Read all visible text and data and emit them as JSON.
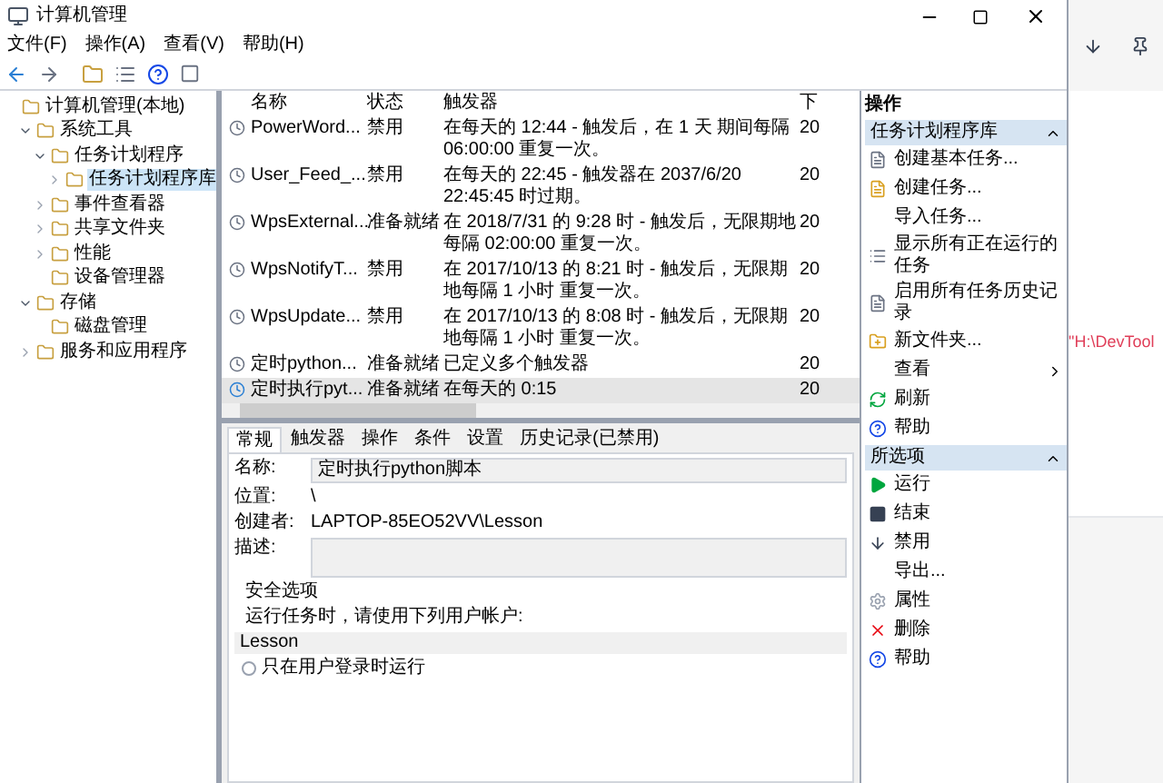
{
  "window": {
    "title": "计算机管理"
  },
  "menu": [
    "文件(F)",
    "操作(A)",
    "查看(V)",
    "帮助(H)"
  ],
  "tree": {
    "label": "计算机管理(本地)",
    "selected": false,
    "children": [
      {
        "label": "系统工具",
        "expanded": true,
        "selected": false,
        "children": [
          {
            "label": "任务计划程序",
            "expanded": true,
            "selected": false,
            "children": [
              {
                "label": "任务计划程序库",
                "expanded": false,
                "selected": true
              }
            ]
          },
          {
            "label": "事件查看器",
            "expanded": false,
            "selected": false
          },
          {
            "label": "共享文件夹",
            "expanded": false,
            "selected": false
          },
          {
            "label": "性能",
            "expanded": false,
            "selected": false
          },
          {
            "label": "设备管理器",
            "selected": false
          }
        ]
      },
      {
        "label": "存储",
        "expanded": true,
        "selected": false,
        "children": [
          {
            "label": "磁盘管理",
            "selected": false
          }
        ]
      },
      {
        "label": "服务和应用程序",
        "expanded": false,
        "selected": false
      }
    ]
  },
  "table": {
    "columns": [
      "名称",
      "状态",
      "触发器",
      "下"
    ],
    "rows": [
      {
        "cells": [
          "PowerWord...",
          "禁用",
          "在每天的 12:44 - 触发后，在 1 天 期间每隔 06:00:00 重复一次。",
          "20"
        ],
        "selected": false
      },
      {
        "cells": [
          "User_Feed_...",
          "禁用",
          "在每天的 22:45 - 触发器在 2037/6/20 22:45:45 时过期。",
          "20"
        ],
        "selected": false
      },
      {
        "cells": [
          "WpsExternal...",
          "准备就绪",
          "在 2018/7/31 的 9:28 时 - 触发后，无限期地每隔 02:00:00 重复一次。",
          "20"
        ],
        "selected": false
      },
      {
        "cells": [
          "WpsNotifyT...",
          "禁用",
          "在 2017/10/13 的 8:21 时 - 触发后，无限期地每隔 1 小时 重复一次。",
          "20"
        ],
        "selected": false
      },
      {
        "cells": [
          "WpsUpdate...",
          "禁用",
          "在 2017/10/13 的 8:08 时 - 触发后，无限期地每隔 1 小时 重复一次。",
          "20"
        ],
        "selected": false
      },
      {
        "cells": [
          "定时python...",
          "准备就绪",
          "已定义多个触发器",
          "20"
        ],
        "selected": false
      },
      {
        "cells": [
          "定时执行pyt...",
          "准备就绪",
          "在每天的 0:15",
          "20"
        ],
        "selected": true
      }
    ]
  },
  "detail": {
    "tabs": [
      {
        "label": "常规",
        "selected": true
      },
      {
        "label": "触发器",
        "selected": false
      },
      {
        "label": "操作",
        "selected": false
      },
      {
        "label": "条件",
        "selected": false
      },
      {
        "label": "设置",
        "selected": false
      },
      {
        "label": "历史记录(已禁用)",
        "selected": false
      }
    ],
    "fields": [
      {
        "label": "名称:",
        "value": "定时执行python脚本",
        "kind": "input"
      },
      {
        "label": "位置:",
        "value": "\\",
        "kind": "text"
      },
      {
        "label": "创建者:",
        "value": "LAPTOP-85EO52VV\\Lesson",
        "kind": "text"
      },
      {
        "label": "描述:",
        "kind": "area"
      }
    ],
    "security_title": "安全选项",
    "security_prompt": "运行任务时，请使用下列用户帐户:",
    "account": "Lesson",
    "option": {
      "label": "只在用户登录时运行",
      "checked": false
    }
  },
  "actions": {
    "title": "操作",
    "sections": [
      {
        "title": "任务计划程序库",
        "items": [
          {
            "label": "创建基本任务...",
            "kind": "basic"
          },
          {
            "label": "创建任务...",
            "kind": "task"
          },
          {
            "label": "导入任务...",
            "kind": "none"
          },
          {
            "label": "显示所有正在运行的任务",
            "kind": "running"
          },
          {
            "label": "启用所有任务历史记录",
            "kind": "history"
          },
          {
            "label": "新文件夹...",
            "kind": "folder"
          },
          {
            "label": "查看",
            "kind": "submenu"
          },
          {
            "label": "刷新",
            "kind": "refresh"
          },
          {
            "label": "帮助",
            "kind": "help"
          }
        ]
      },
      {
        "title": "所选项",
        "items": [
          {
            "label": "运行",
            "kind": "run"
          },
          {
            "label": "结束",
            "kind": "stop"
          },
          {
            "label": "禁用",
            "kind": "disable"
          },
          {
            "label": "导出...",
            "kind": "none"
          },
          {
            "label": "属性",
            "kind": "props"
          },
          {
            "label": "删除",
            "kind": "delete"
          },
          {
            "label": "帮助",
            "kind": "help"
          }
        ]
      }
    ]
  },
  "background": {
    "path_text": "\"H:\\DevTool"
  }
}
